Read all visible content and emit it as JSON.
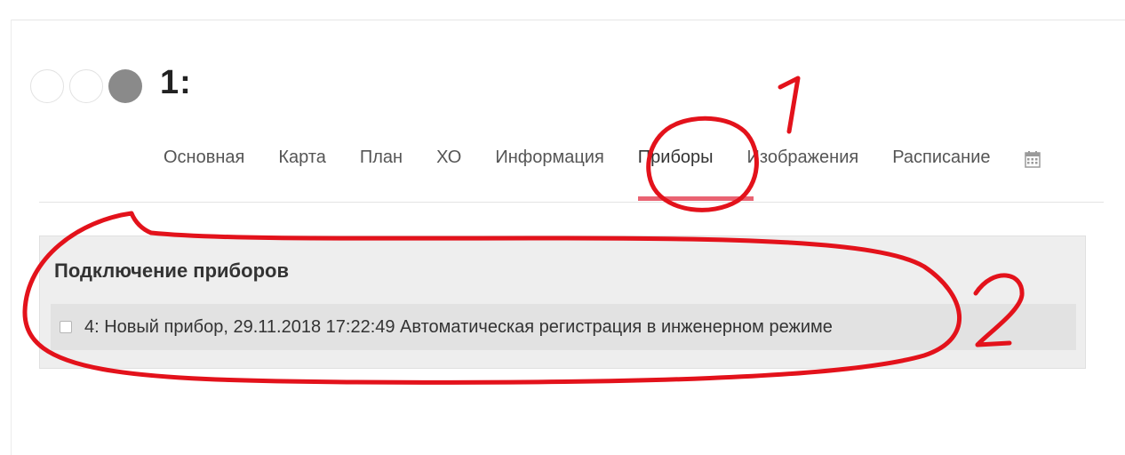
{
  "header": {
    "title": "1:",
    "status_indicators": [
      "empty",
      "empty",
      "filled"
    ]
  },
  "tabs": [
    {
      "label": "Основная",
      "active": false
    },
    {
      "label": "Карта",
      "active": false
    },
    {
      "label": "План",
      "active": false
    },
    {
      "label": "ХО",
      "active": false
    },
    {
      "label": "Информация",
      "active": false
    },
    {
      "label": "Приборы",
      "active": true
    },
    {
      "label": "Изображения",
      "active": false
    },
    {
      "label": "Расписание",
      "active": false
    }
  ],
  "tab_extra_icon": "calendar-icon",
  "panel": {
    "title": "Подключение приборов",
    "devices": [
      {
        "checked": false,
        "text": "4: Новый прибор, 29.11.2018 17:22:49 Автоматическая регистрация в инженерном режиме"
      }
    ]
  },
  "annotations": {
    "mark_1": "1",
    "mark_2": "2",
    "color": "#e3121b"
  },
  "colors": {
    "active_tab_underline": "#e96372",
    "panel_background": "#eeeeee",
    "row_background": "#e2e2e2",
    "status_filled": "#8a8a8a"
  }
}
